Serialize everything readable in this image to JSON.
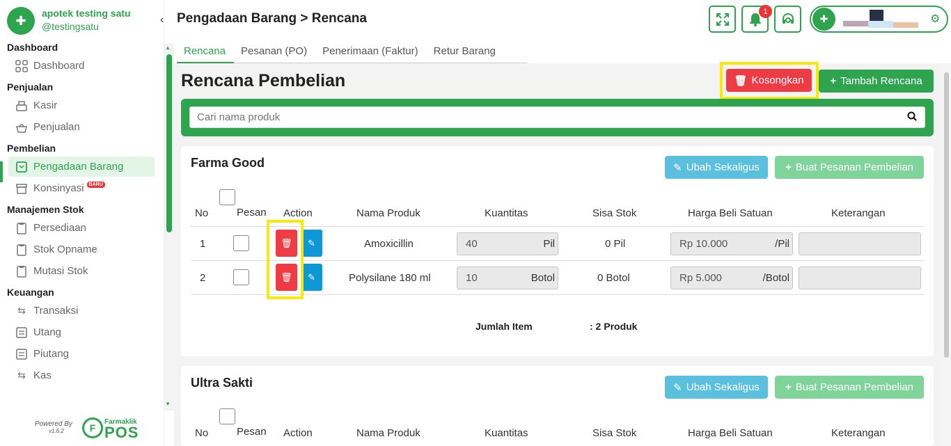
{
  "brand": {
    "name": "apotek testing satu",
    "username": "@testingsatu"
  },
  "sidebar": {
    "collapse_icon": "chevron-left-icon",
    "sections": [
      {
        "title": "Dashboard",
        "items": [
          {
            "label": "Dashboard",
            "icon": "grid-icon"
          }
        ]
      },
      {
        "title": "Penjualan",
        "items": [
          {
            "label": "Kasir",
            "icon": "cash-register-icon"
          },
          {
            "label": "Penjualan",
            "icon": "basket-icon"
          }
        ]
      },
      {
        "title": "Pembelian",
        "items": [
          {
            "label": "Pengadaan Barang",
            "icon": "box-icon",
            "active": true
          },
          {
            "label": "Konsinyasi",
            "icon": "archive-icon",
            "badge": "BARU"
          }
        ]
      },
      {
        "title": "Manajemen Stok",
        "items": [
          {
            "label": "Persediaan",
            "icon": "clipboard-icon"
          },
          {
            "label": "Stok Opname",
            "icon": "clipboard-check-icon"
          },
          {
            "label": "Mutasi Stok",
            "icon": "clipboard-transfer-icon"
          }
        ]
      },
      {
        "title": "Keuangan",
        "items": [
          {
            "label": "Transaksi",
            "icon": "exchange-icon"
          },
          {
            "label": "Utang",
            "icon": "list-icon"
          },
          {
            "label": "Piutang",
            "icon": "list-icon"
          },
          {
            "label": "Kas",
            "icon": "exchange-icon"
          }
        ]
      }
    ],
    "footer": {
      "powered_by": "Powered By",
      "version": "v1.6.2",
      "logo_small": "Farmaklik",
      "logo_big": "POS"
    }
  },
  "header": {
    "title": "Pengadaan Barang > Rencana",
    "notification_count": "1",
    "accent": "#2ea44f"
  },
  "tabs": [
    {
      "label": "Rencana",
      "active": true
    },
    {
      "label": "Pesanan (PO)"
    },
    {
      "label": "Penerimaan (Faktur)"
    },
    {
      "label": "Retur Barang"
    }
  ],
  "main": {
    "title": "Rencana Pembelian",
    "kosongkan_label": "Kosongkan",
    "tambah_label": "Tambah Rencana",
    "search_placeholder": "Cari nama produk"
  },
  "columns": [
    "No",
    "Pesan",
    "Action",
    "Nama Produk",
    "Kuantitas",
    "Sisa Stok",
    "Harga Beli Satuan",
    "Keterangan"
  ],
  "suppliers": [
    {
      "name": "Farma Good",
      "ubah_label": "Ubah Sekaligus",
      "buat_label": "Buat Pesanan Pembelian",
      "rows": [
        {
          "no": "1",
          "product": "Amoxicillin",
          "qty": "40",
          "qty_unit": "Pil",
          "stock": "0 Pil",
          "price": "Rp 10.000",
          "price_unit": "/Pil",
          "note": ""
        },
        {
          "no": "2",
          "product": "Polysilane 180 ml",
          "qty": "10",
          "qty_unit": "Botol",
          "stock": "0 Botol",
          "price": "Rp 5.000",
          "price_unit": "/Botol",
          "note": ""
        }
      ],
      "summary_label": "Jumlah Item",
      "summary_value": ": 2 Produk"
    },
    {
      "name": "Ultra Sakti",
      "ubah_label": "Ubah Sekaligus",
      "buat_label": "Buat Pesanan Pembelian"
    }
  ]
}
